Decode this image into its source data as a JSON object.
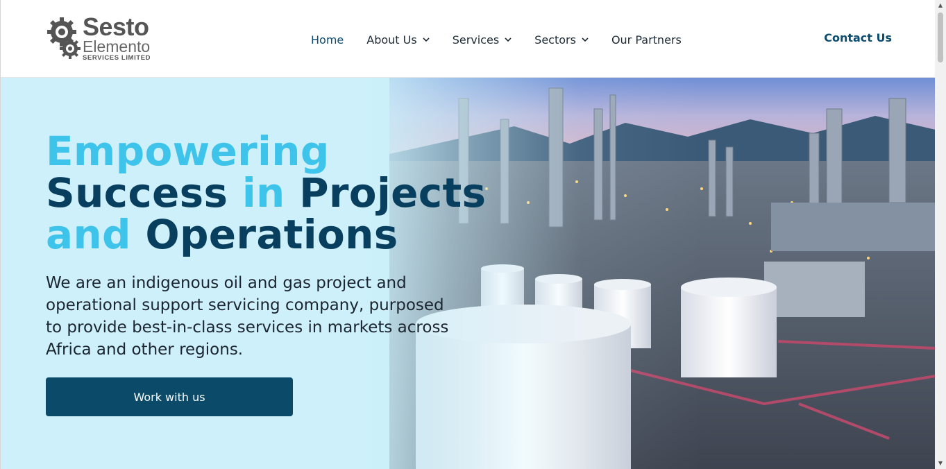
{
  "brand": {
    "name_line1": "Sesto",
    "name_line2": "Elemento",
    "name_line3": "SERVICES LIMITED"
  },
  "nav": {
    "items": [
      {
        "label": "Home",
        "dropdown": false,
        "active": true
      },
      {
        "label": "About Us",
        "dropdown": true
      },
      {
        "label": "Services",
        "dropdown": true
      },
      {
        "label": "Sectors",
        "dropdown": true
      },
      {
        "label": "Our Partners",
        "dropdown": false
      }
    ],
    "contact_label": "Contact Us"
  },
  "hero": {
    "headline": {
      "word1": "Empowering",
      "word2": "Success",
      "word3": "in",
      "word4": "Projects",
      "word5": "and",
      "word6": "Operations"
    },
    "intro": "We are an indigenous oil and gas project and operational support servicing company, purposed to provide best-in-class services in markets across Africa and other regions.",
    "cta_label": "Work with us"
  },
  "colors": {
    "accent_light": "#3ec3ea",
    "brand_dark": "#083f5e",
    "button": "#0b4a68"
  }
}
